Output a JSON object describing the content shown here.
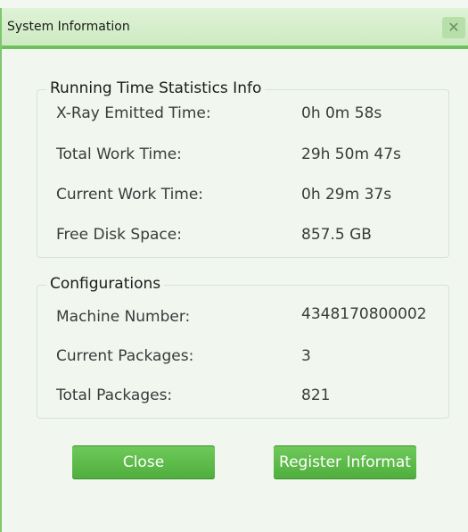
{
  "window": {
    "title": "System Information",
    "close_glyph": "✕"
  },
  "running_time": {
    "title": "Running Time Statistics Info",
    "rows": [
      {
        "label": "X-Ray Emitted Time:",
        "value": "0h 0m 58s"
      },
      {
        "label": "Total Work Time:",
        "value": "29h 50m 47s"
      },
      {
        "label": "Current Work Time:",
        "value": "0h 29m 37s"
      },
      {
        "label": "Free Disk Space:",
        "value": "857.5 GB"
      }
    ]
  },
  "configurations": {
    "title": "Configurations",
    "rows": [
      {
        "label": "Machine Number:",
        "value": "4348170800002"
      },
      {
        "label": "Current Packages:",
        "value": "3"
      },
      {
        "label": "Total Packages:",
        "value": "821"
      }
    ]
  },
  "buttons": {
    "close_label": "Close",
    "register_label": "Register Informat"
  },
  "colors": {
    "accent": "#6dc05b",
    "button_green": "#5dbb49",
    "title_bg": "#d6eecb"
  },
  "icons": {
    "close": "close-icon"
  }
}
